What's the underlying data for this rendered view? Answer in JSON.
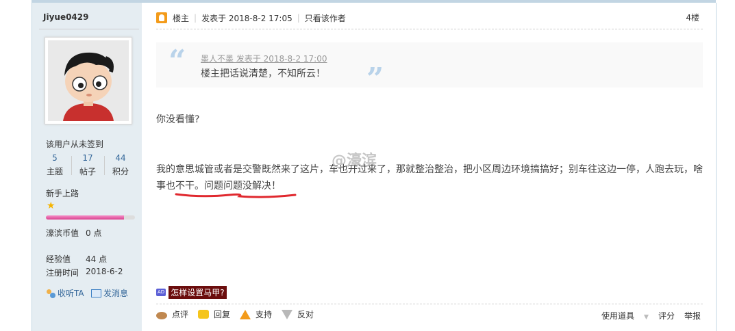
{
  "user": {
    "name": "Jiyue0429",
    "signin_text": "该用户从未签到",
    "stats": [
      {
        "value": "5",
        "label": "主题"
      },
      {
        "value": "17",
        "label": "帖子"
      },
      {
        "value": "44",
        "label": "积分"
      }
    ],
    "level_name": "新手上路",
    "level_progress": 0.88,
    "coin_label": "濠滨币值",
    "coin_value": "0 点",
    "exp_label": "经验值",
    "exp_value": "44 点",
    "reg_label": "注册时间",
    "reg_value": "2018-6-2",
    "follow_label": "收听TA",
    "message_label": "发消息"
  },
  "post": {
    "author_role": "楼主",
    "posted_at": "发表于 2018-8-2 17:05",
    "only_author": "只看该作者",
    "floor": "4楼",
    "quote_header": "墨人不墨 发表于 2018-8-2 17:00",
    "quote_text": "楼主把话说清楚，不知所云！",
    "paragraph1": "你没看懂?",
    "paragraph2": "我的意思城管或者是交警既然来了这片，车也开过来了，那就整治整治，把小区周边环境搞搞好；别车往这边一停，人跑去玩，啥事也不干。问题问题没解决！",
    "watermark": "@濠滨",
    "ad_badge": "AD",
    "ad_text": "怎样设置马甲?"
  },
  "actions": {
    "comment": "点评",
    "reply": "回复",
    "support": "支持",
    "oppose": "反对",
    "tools": "使用道具",
    "rate": "评分",
    "report": "举报"
  },
  "colors": {
    "sidebar_bg": "#e5edf2",
    "border": "#c2d5e3",
    "link": "#336699",
    "annotation": "#e0282e",
    "ad_bg": "#6b0d0d"
  }
}
